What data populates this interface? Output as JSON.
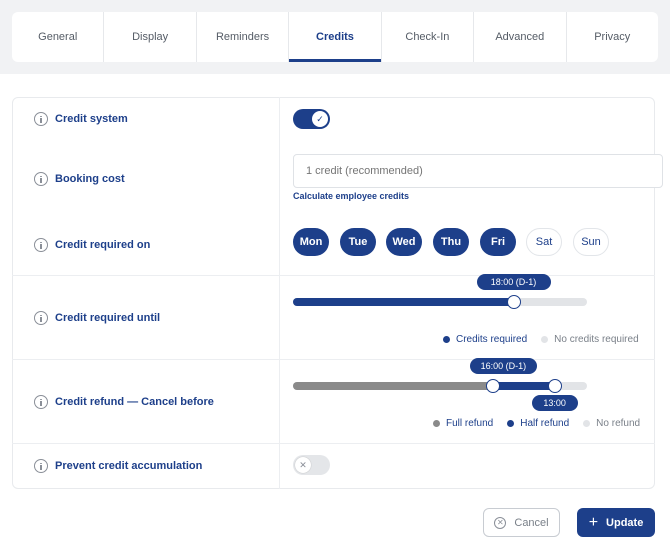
{
  "tabs": [
    {
      "label": "General"
    },
    {
      "label": "Display"
    },
    {
      "label": "Reminders"
    },
    {
      "label": "Credits"
    },
    {
      "label": "Check-In"
    },
    {
      "label": "Advanced"
    },
    {
      "label": "Privacy"
    }
  ],
  "active_tab": "Credits",
  "rows": {
    "credit_system": {
      "label": "Credit system",
      "enabled": true
    },
    "booking_cost": {
      "label": "Booking cost",
      "value": "",
      "placeholder": "1 credit (recommended)",
      "link": "Calculate employee credits"
    },
    "credit_required_on": {
      "label": "Credit required on",
      "days": [
        {
          "label": "Mon",
          "selected": true
        },
        {
          "label": "Tue",
          "selected": true
        },
        {
          "label": "Wed",
          "selected": true
        },
        {
          "label": "Thu",
          "selected": true
        },
        {
          "label": "Fri",
          "selected": true
        },
        {
          "label": "Sat",
          "selected": false
        },
        {
          "label": "Sun",
          "selected": false
        }
      ]
    },
    "credit_required_until": {
      "label": "Credit required until",
      "value_label": "18:00 (D-1)",
      "fill_fraction": 0.75,
      "legend": [
        {
          "label": "Credits required",
          "color": "#1d3f8a"
        },
        {
          "label": "No credits required",
          "color": "#e2e4e7"
        }
      ]
    },
    "credit_refund": {
      "label": "Credit refund — Cancel before",
      "full_label": "16:00 (D-1)",
      "half_label": "13:00",
      "full_fraction": 0.68,
      "half_fraction": 0.89,
      "legend": [
        {
          "label": "Full refund",
          "color": "#8a8a8a"
        },
        {
          "label": "Half refund",
          "color": "#1d3f8a"
        },
        {
          "label": "No refund",
          "color": "#e2e4e7"
        }
      ]
    },
    "prevent_accumulation": {
      "label": "Prevent credit accumulation",
      "enabled": false
    }
  },
  "buttons": {
    "cancel": "Cancel",
    "update": "Update"
  },
  "colors": {
    "primary": "#1d3f8a",
    "grey_fill": "#8a8a8a",
    "track": "#e2e4e7"
  },
  "icons": {
    "info": "info-icon",
    "check": "check-icon",
    "x": "x-icon",
    "cancel": "x-circle-icon",
    "update": "plus-icon"
  }
}
